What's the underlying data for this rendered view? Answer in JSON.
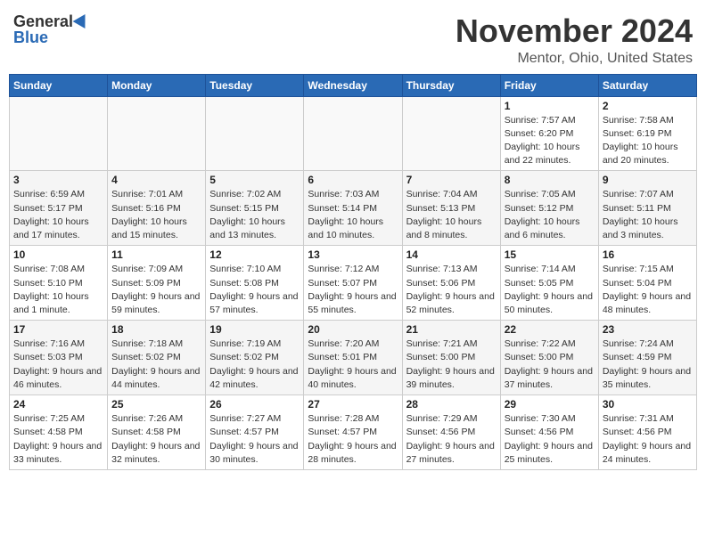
{
  "header": {
    "logo_general": "General",
    "logo_blue": "Blue",
    "title": "November 2024",
    "subtitle": "Mentor, Ohio, United States"
  },
  "days_of_week": [
    "Sunday",
    "Monday",
    "Tuesday",
    "Wednesday",
    "Thursday",
    "Friday",
    "Saturday"
  ],
  "weeks": [
    [
      {
        "day": "",
        "info": ""
      },
      {
        "day": "",
        "info": ""
      },
      {
        "day": "",
        "info": ""
      },
      {
        "day": "",
        "info": ""
      },
      {
        "day": "",
        "info": ""
      },
      {
        "day": "1",
        "info": "Sunrise: 7:57 AM\nSunset: 6:20 PM\nDaylight: 10 hours and 22 minutes."
      },
      {
        "day": "2",
        "info": "Sunrise: 7:58 AM\nSunset: 6:19 PM\nDaylight: 10 hours and 20 minutes."
      }
    ],
    [
      {
        "day": "3",
        "info": "Sunrise: 6:59 AM\nSunset: 5:17 PM\nDaylight: 10 hours and 17 minutes."
      },
      {
        "day": "4",
        "info": "Sunrise: 7:01 AM\nSunset: 5:16 PM\nDaylight: 10 hours and 15 minutes."
      },
      {
        "day": "5",
        "info": "Sunrise: 7:02 AM\nSunset: 5:15 PM\nDaylight: 10 hours and 13 minutes."
      },
      {
        "day": "6",
        "info": "Sunrise: 7:03 AM\nSunset: 5:14 PM\nDaylight: 10 hours and 10 minutes."
      },
      {
        "day": "7",
        "info": "Sunrise: 7:04 AM\nSunset: 5:13 PM\nDaylight: 10 hours and 8 minutes."
      },
      {
        "day": "8",
        "info": "Sunrise: 7:05 AM\nSunset: 5:12 PM\nDaylight: 10 hours and 6 minutes."
      },
      {
        "day": "9",
        "info": "Sunrise: 7:07 AM\nSunset: 5:11 PM\nDaylight: 10 hours and 3 minutes."
      }
    ],
    [
      {
        "day": "10",
        "info": "Sunrise: 7:08 AM\nSunset: 5:10 PM\nDaylight: 10 hours and 1 minute."
      },
      {
        "day": "11",
        "info": "Sunrise: 7:09 AM\nSunset: 5:09 PM\nDaylight: 9 hours and 59 minutes."
      },
      {
        "day": "12",
        "info": "Sunrise: 7:10 AM\nSunset: 5:08 PM\nDaylight: 9 hours and 57 minutes."
      },
      {
        "day": "13",
        "info": "Sunrise: 7:12 AM\nSunset: 5:07 PM\nDaylight: 9 hours and 55 minutes."
      },
      {
        "day": "14",
        "info": "Sunrise: 7:13 AM\nSunset: 5:06 PM\nDaylight: 9 hours and 52 minutes."
      },
      {
        "day": "15",
        "info": "Sunrise: 7:14 AM\nSunset: 5:05 PM\nDaylight: 9 hours and 50 minutes."
      },
      {
        "day": "16",
        "info": "Sunrise: 7:15 AM\nSunset: 5:04 PM\nDaylight: 9 hours and 48 minutes."
      }
    ],
    [
      {
        "day": "17",
        "info": "Sunrise: 7:16 AM\nSunset: 5:03 PM\nDaylight: 9 hours and 46 minutes."
      },
      {
        "day": "18",
        "info": "Sunrise: 7:18 AM\nSunset: 5:02 PM\nDaylight: 9 hours and 44 minutes."
      },
      {
        "day": "19",
        "info": "Sunrise: 7:19 AM\nSunset: 5:02 PM\nDaylight: 9 hours and 42 minutes."
      },
      {
        "day": "20",
        "info": "Sunrise: 7:20 AM\nSunset: 5:01 PM\nDaylight: 9 hours and 40 minutes."
      },
      {
        "day": "21",
        "info": "Sunrise: 7:21 AM\nSunset: 5:00 PM\nDaylight: 9 hours and 39 minutes."
      },
      {
        "day": "22",
        "info": "Sunrise: 7:22 AM\nSunset: 5:00 PM\nDaylight: 9 hours and 37 minutes."
      },
      {
        "day": "23",
        "info": "Sunrise: 7:24 AM\nSunset: 4:59 PM\nDaylight: 9 hours and 35 minutes."
      }
    ],
    [
      {
        "day": "24",
        "info": "Sunrise: 7:25 AM\nSunset: 4:58 PM\nDaylight: 9 hours and 33 minutes."
      },
      {
        "day": "25",
        "info": "Sunrise: 7:26 AM\nSunset: 4:58 PM\nDaylight: 9 hours and 32 minutes."
      },
      {
        "day": "26",
        "info": "Sunrise: 7:27 AM\nSunset: 4:57 PM\nDaylight: 9 hours and 30 minutes."
      },
      {
        "day": "27",
        "info": "Sunrise: 7:28 AM\nSunset: 4:57 PM\nDaylight: 9 hours and 28 minutes."
      },
      {
        "day": "28",
        "info": "Sunrise: 7:29 AM\nSunset: 4:56 PM\nDaylight: 9 hours and 27 minutes."
      },
      {
        "day": "29",
        "info": "Sunrise: 7:30 AM\nSunset: 4:56 PM\nDaylight: 9 hours and 25 minutes."
      },
      {
        "day": "30",
        "info": "Sunrise: 7:31 AM\nSunset: 4:56 PM\nDaylight: 9 hours and 24 minutes."
      }
    ]
  ]
}
